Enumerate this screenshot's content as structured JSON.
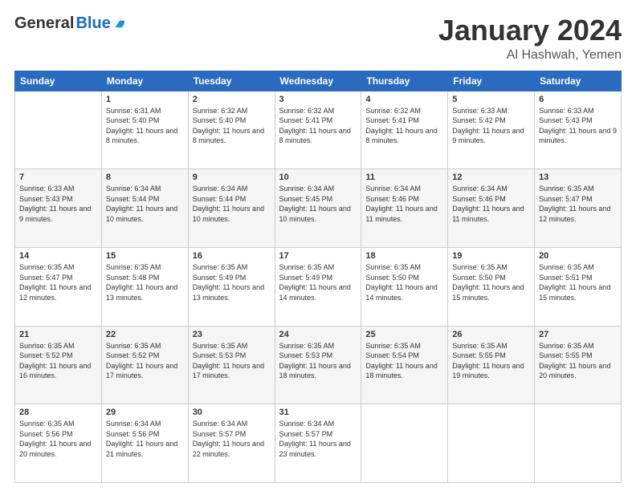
{
  "header": {
    "logo_general": "General",
    "logo_blue": "Blue",
    "month_title": "January 2024",
    "location": "Al Hashwah, Yemen"
  },
  "days_of_week": [
    "Sunday",
    "Monday",
    "Tuesday",
    "Wednesday",
    "Thursday",
    "Friday",
    "Saturday"
  ],
  "weeks": [
    [
      {
        "day": "",
        "sunrise": "",
        "sunset": "",
        "daylight": ""
      },
      {
        "day": "1",
        "sunrise": "Sunrise: 6:31 AM",
        "sunset": "Sunset: 5:40 PM",
        "daylight": "Daylight: 11 hours and 8 minutes."
      },
      {
        "day": "2",
        "sunrise": "Sunrise: 6:32 AM",
        "sunset": "Sunset: 5:40 PM",
        "daylight": "Daylight: 11 hours and 8 minutes."
      },
      {
        "day": "3",
        "sunrise": "Sunrise: 6:32 AM",
        "sunset": "Sunset: 5:41 PM",
        "daylight": "Daylight: 11 hours and 8 minutes."
      },
      {
        "day": "4",
        "sunrise": "Sunrise: 6:32 AM",
        "sunset": "Sunset: 5:41 PM",
        "daylight": "Daylight: 11 hours and 8 minutes."
      },
      {
        "day": "5",
        "sunrise": "Sunrise: 6:33 AM",
        "sunset": "Sunset: 5:42 PM",
        "daylight": "Daylight: 11 hours and 9 minutes."
      },
      {
        "day": "6",
        "sunrise": "Sunrise: 6:33 AM",
        "sunset": "Sunset: 5:43 PM",
        "daylight": "Daylight: 11 hours and 9 minutes."
      }
    ],
    [
      {
        "day": "7",
        "sunrise": "Sunrise: 6:33 AM",
        "sunset": "Sunset: 5:43 PM",
        "daylight": "Daylight: 11 hours and 9 minutes."
      },
      {
        "day": "8",
        "sunrise": "Sunrise: 6:34 AM",
        "sunset": "Sunset: 5:44 PM",
        "daylight": "Daylight: 11 hours and 10 minutes."
      },
      {
        "day": "9",
        "sunrise": "Sunrise: 6:34 AM",
        "sunset": "Sunset: 5:44 PM",
        "daylight": "Daylight: 11 hours and 10 minutes."
      },
      {
        "day": "10",
        "sunrise": "Sunrise: 6:34 AM",
        "sunset": "Sunset: 5:45 PM",
        "daylight": "Daylight: 11 hours and 10 minutes."
      },
      {
        "day": "11",
        "sunrise": "Sunrise: 6:34 AM",
        "sunset": "Sunset: 5:46 PM",
        "daylight": "Daylight: 11 hours and 11 minutes."
      },
      {
        "day": "12",
        "sunrise": "Sunrise: 6:34 AM",
        "sunset": "Sunset: 5:46 PM",
        "daylight": "Daylight: 11 hours and 11 minutes."
      },
      {
        "day": "13",
        "sunrise": "Sunrise: 6:35 AM",
        "sunset": "Sunset: 5:47 PM",
        "daylight": "Daylight: 11 hours and 12 minutes."
      }
    ],
    [
      {
        "day": "14",
        "sunrise": "Sunrise: 6:35 AM",
        "sunset": "Sunset: 5:47 PM",
        "daylight": "Daylight: 11 hours and 12 minutes."
      },
      {
        "day": "15",
        "sunrise": "Sunrise: 6:35 AM",
        "sunset": "Sunset: 5:48 PM",
        "daylight": "Daylight: 11 hours and 13 minutes."
      },
      {
        "day": "16",
        "sunrise": "Sunrise: 6:35 AM",
        "sunset": "Sunset: 5:49 PM",
        "daylight": "Daylight: 11 hours and 13 minutes."
      },
      {
        "day": "17",
        "sunrise": "Sunrise: 6:35 AM",
        "sunset": "Sunset: 5:49 PM",
        "daylight": "Daylight: 11 hours and 14 minutes."
      },
      {
        "day": "18",
        "sunrise": "Sunrise: 6:35 AM",
        "sunset": "Sunset: 5:50 PM",
        "daylight": "Daylight: 11 hours and 14 minutes."
      },
      {
        "day": "19",
        "sunrise": "Sunrise: 6:35 AM",
        "sunset": "Sunset: 5:50 PM",
        "daylight": "Daylight: 11 hours and 15 minutes."
      },
      {
        "day": "20",
        "sunrise": "Sunrise: 6:35 AM",
        "sunset": "Sunset: 5:51 PM",
        "daylight": "Daylight: 11 hours and 15 minutes."
      }
    ],
    [
      {
        "day": "21",
        "sunrise": "Sunrise: 6:35 AM",
        "sunset": "Sunset: 5:52 PM",
        "daylight": "Daylight: 11 hours and 16 minutes."
      },
      {
        "day": "22",
        "sunrise": "Sunrise: 6:35 AM",
        "sunset": "Sunset: 5:52 PM",
        "daylight": "Daylight: 11 hours and 17 minutes."
      },
      {
        "day": "23",
        "sunrise": "Sunrise: 6:35 AM",
        "sunset": "Sunset: 5:53 PM",
        "daylight": "Daylight: 11 hours and 17 minutes."
      },
      {
        "day": "24",
        "sunrise": "Sunrise: 6:35 AM",
        "sunset": "Sunset: 5:53 PM",
        "daylight": "Daylight: 11 hours and 18 minutes."
      },
      {
        "day": "25",
        "sunrise": "Sunrise: 6:35 AM",
        "sunset": "Sunset: 5:54 PM",
        "daylight": "Daylight: 11 hours and 18 minutes."
      },
      {
        "day": "26",
        "sunrise": "Sunrise: 6:35 AM",
        "sunset": "Sunset: 5:55 PM",
        "daylight": "Daylight: 11 hours and 19 minutes."
      },
      {
        "day": "27",
        "sunrise": "Sunrise: 6:35 AM",
        "sunset": "Sunset: 5:55 PM",
        "daylight": "Daylight: 11 hours and 20 minutes."
      }
    ],
    [
      {
        "day": "28",
        "sunrise": "Sunrise: 6:35 AM",
        "sunset": "Sunset: 5:56 PM",
        "daylight": "Daylight: 11 hours and 20 minutes."
      },
      {
        "day": "29",
        "sunrise": "Sunrise: 6:34 AM",
        "sunset": "Sunset: 5:56 PM",
        "daylight": "Daylight: 11 hours and 21 minutes."
      },
      {
        "day": "30",
        "sunrise": "Sunrise: 6:34 AM",
        "sunset": "Sunset: 5:57 PM",
        "daylight": "Daylight: 11 hours and 22 minutes."
      },
      {
        "day": "31",
        "sunrise": "Sunrise: 6:34 AM",
        "sunset": "Sunset: 5:57 PM",
        "daylight": "Daylight: 11 hours and 23 minutes."
      },
      {
        "day": "",
        "sunrise": "",
        "sunset": "",
        "daylight": ""
      },
      {
        "day": "",
        "sunrise": "",
        "sunset": "",
        "daylight": ""
      },
      {
        "day": "",
        "sunrise": "",
        "sunset": "",
        "daylight": ""
      }
    ]
  ]
}
